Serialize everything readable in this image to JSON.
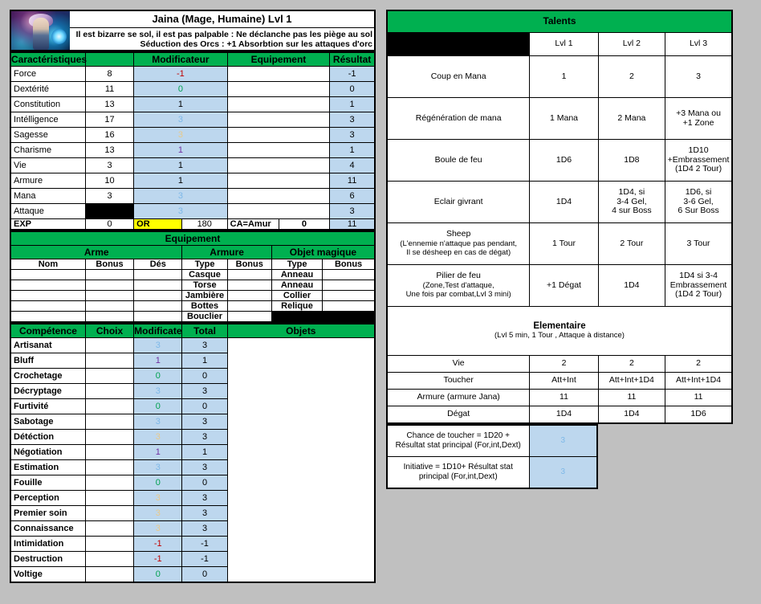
{
  "character": {
    "name": "Jaina (Mage, Humaine) Lvl 1",
    "notes": [
      "Il est bizarre se sol, il est pas palpable : Ne déclanche pas les piège au sol",
      "Séduction des Orcs : +1 Absorbtion sur les attaques d'orc"
    ],
    "portrait_alt": "character-portrait"
  },
  "stats_table": {
    "headers": [
      "Caractéristiques",
      "",
      "Modificateur",
      "Equipement",
      "Résultat"
    ],
    "rows": [
      {
        "name": "Force",
        "value": "8",
        "mod": "-1",
        "mod_color": "m-red",
        "equip": "",
        "result": "-1"
      },
      {
        "name": "Dextérité",
        "value": "11",
        "mod": "0",
        "mod_color": "m-green",
        "equip": "",
        "result": "0"
      },
      {
        "name": "Constitution",
        "value": "13",
        "mod": "1",
        "mod_color": "m-black",
        "equip": "",
        "result": "1"
      },
      {
        "name": "Intélligence",
        "value": "17",
        "mod": "3",
        "mod_color": "m-blue",
        "equip": "",
        "result": "3"
      },
      {
        "name": "Sagesse",
        "value": "16",
        "mod": "3",
        "mod_color": "m-tan",
        "equip": "",
        "result": "3"
      },
      {
        "name": "Charisme",
        "value": "13",
        "mod": "1",
        "mod_color": "m-purple",
        "equip": "",
        "result": "1"
      },
      {
        "name": "Vie",
        "value": "3",
        "mod": "1",
        "mod_color": "m-black",
        "equip": "",
        "result": "4"
      },
      {
        "name": "Armure",
        "value": "10",
        "mod": "1",
        "mod_color": "m-black",
        "equip": "",
        "result": "11"
      },
      {
        "name": "Mana",
        "value": "3",
        "mod": "3",
        "mod_color": "m-blue",
        "equip": "",
        "result": "6"
      },
      {
        "name": "Attaque",
        "value": "",
        "mod": "3",
        "mod_color": "m-blue",
        "equip": "",
        "result": "3",
        "value_black": true
      }
    ],
    "exp_row": {
      "exp_label": "EXP",
      "exp_value": "0",
      "gold_label": "OR",
      "gold_value": "180",
      "ca_label": "CA=Amur",
      "ca_value": "0",
      "result": "11"
    }
  },
  "equipment": {
    "title": "Equipement",
    "groups": [
      "Arme",
      "Armure",
      "Objet magique"
    ],
    "columns": [
      "Nom",
      "Bonus",
      "Dés",
      "Type",
      "Bonus",
      "Type",
      "Bonus"
    ],
    "rows": [
      {
        "arme_nom": "",
        "arme_bonus": "",
        "arme_des": "",
        "armure_type": "Casque",
        "armure_bonus": "",
        "magique_type": "Anneau",
        "magique_bonus": ""
      },
      {
        "arme_nom": "",
        "arme_bonus": "",
        "arme_des": "",
        "armure_type": "Torse",
        "armure_bonus": "",
        "magique_type": "Anneau",
        "magique_bonus": ""
      },
      {
        "arme_nom": "",
        "arme_bonus": "",
        "arme_des": "",
        "armure_type": "Jambière",
        "armure_bonus": "",
        "magique_type": "Collier",
        "magique_bonus": ""
      },
      {
        "arme_nom": "",
        "arme_bonus": "",
        "arme_des": "",
        "armure_type": "Bottes",
        "armure_bonus": "",
        "magique_type": "Relique",
        "magique_bonus": ""
      },
      {
        "arme_nom": "",
        "arme_bonus": "",
        "arme_des": "",
        "armure_type": "Bouclier",
        "armure_bonus": "",
        "magique_type": "",
        "magique_bonus": "",
        "magique_black": true
      }
    ]
  },
  "skills": {
    "headers": [
      "Compétence",
      "Choix",
      "Modificateur",
      "Total",
      "Objets"
    ],
    "rows": [
      {
        "name": "Artisanat",
        "choix": "",
        "mod": "3",
        "mod_color": "m-blue",
        "total": "3"
      },
      {
        "name": "Bluff",
        "choix": "",
        "mod": "1",
        "mod_color": "m-purple",
        "total": "1"
      },
      {
        "name": "Crochetage",
        "choix": "",
        "mod": "0",
        "mod_color": "m-green",
        "total": "0"
      },
      {
        "name": "Décryptage",
        "choix": "",
        "mod": "3",
        "mod_color": "m-blue",
        "total": "3"
      },
      {
        "name": "Furtivité",
        "choix": "",
        "mod": "0",
        "mod_color": "m-green",
        "total": "0"
      },
      {
        "name": "Sabotage",
        "choix": "",
        "mod": "3",
        "mod_color": "m-blue",
        "total": "3"
      },
      {
        "name": "Détéction",
        "choix": "",
        "mod": "3",
        "mod_color": "m-tan",
        "total": "3"
      },
      {
        "name": "Négotiation",
        "choix": "",
        "mod": "1",
        "mod_color": "m-purple",
        "total": "1"
      },
      {
        "name": "Estimation",
        "choix": "",
        "mod": "3",
        "mod_color": "m-blue",
        "total": "3"
      },
      {
        "name": "Fouille",
        "choix": "",
        "mod": "0",
        "mod_color": "m-green",
        "total": "0"
      },
      {
        "name": "Perception",
        "choix": "",
        "mod": "3",
        "mod_color": "m-tan",
        "total": "3"
      },
      {
        "name": "Premier soin",
        "choix": "",
        "mod": "3",
        "mod_color": "m-tan",
        "total": "3"
      },
      {
        "name": "Connaissance",
        "choix": "",
        "mod": "3",
        "mod_color": "m-tan",
        "total": "3"
      },
      {
        "name": "Intimidation",
        "choix": "",
        "mod": "-1",
        "mod_color": "m-red",
        "total": "-1"
      },
      {
        "name": "Destruction",
        "choix": "",
        "mod": "-1",
        "mod_color": "m-red",
        "total": "-1"
      },
      {
        "name": "Voltige",
        "choix": "",
        "mod": "0",
        "mod_color": "m-green",
        "total": "0"
      }
    ],
    "objets_value": ""
  },
  "talents": {
    "title": "Talents",
    "level_headers": [
      "",
      "Lvl 1",
      "Lvl 2",
      "Lvl 3"
    ],
    "rows": [
      {
        "name": "Coup en Mana",
        "sub": "",
        "lvl1": "1",
        "lvl2": "2",
        "lvl3": "3"
      },
      {
        "name": "Régénération de mana",
        "sub": "",
        "lvl1": "1 Mana",
        "lvl2": "2 Mana",
        "lvl3": "+3 Mana ou\n+1 Zone"
      },
      {
        "name": "Boule de feu",
        "sub": "",
        "lvl1": "1D6",
        "lvl2": "1D8",
        "lvl3": "1D10\n+Embrassement\n(1D4 2 Tour)"
      },
      {
        "name": "Eclair givrant",
        "sub": "",
        "lvl1": "1D4",
        "lvl2": "1D4, si\n3-4 Gel,\n4 sur Boss",
        "lvl3": "1D6, si\n3-6 Gel,\n6 Sur Boss"
      },
      {
        "name": "Sheep",
        "sub": "(L'ennemie n'attaque pas pendant,\nIl se désheep en cas de dégat)",
        "lvl1": "1 Tour",
        "lvl2": "2 Tour",
        "lvl3": "3 Tour"
      },
      {
        "name": "Pilier de feu",
        "sub": "(Zone,Test d'attaque,\nUne fois par combat,Lvl 3 mini)",
        "lvl1": "+1 Dégat",
        "lvl2": "1D4",
        "lvl3": "1D4 si 3-4\nEmbrassement\n(1D4 2 Tour)"
      }
    ],
    "elemental": {
      "title": "Elementaire",
      "subtitle": "(Lvl 5 min, 1 Tour , Attaque à distance)",
      "rows": [
        {
          "name": "Vie",
          "lvl1": "2",
          "lvl2": "2",
          "lvl3": "2"
        },
        {
          "name": "Toucher",
          "lvl1": "Att+Int",
          "lvl2": "Att+Int+1D4",
          "lvl3": "Att+Int+1D4"
        },
        {
          "name": "Armure (armure Jana)",
          "lvl1": "11",
          "lvl2": "11",
          "lvl3": "11"
        },
        {
          "name": "Dégat",
          "lvl1": "1D4",
          "lvl2": "1D4",
          "lvl3": "1D6"
        }
      ]
    },
    "formulas": [
      {
        "label": "Chance de toucher = 1D20 +\nRésultat stat principal (For,int,Dext)",
        "value": "3"
      },
      {
        "label": "Initiative = 1D10+  Résultat stat\nprincipal (For,int,Dext)",
        "value": "3"
      }
    ]
  },
  "colors": {
    "header_green": "#00b050",
    "cell_blue": "#bdd7ee",
    "gold_yellow": "#ffff00",
    "background": "#c0c0c0"
  }
}
